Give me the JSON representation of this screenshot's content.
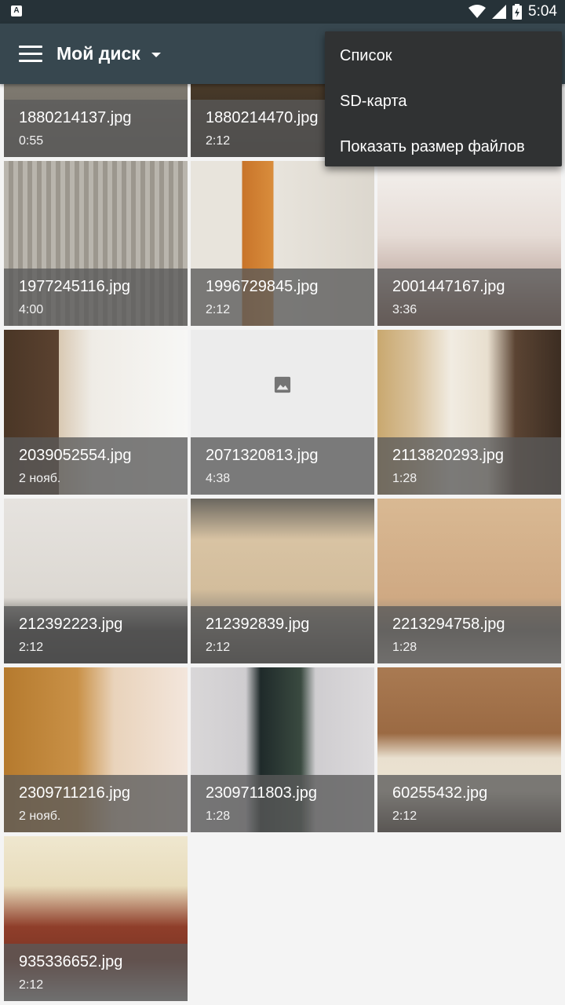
{
  "status_bar": {
    "time": "5:04",
    "notification_icon": "a-box-icon"
  },
  "app_bar": {
    "title": "Мой диск"
  },
  "menu": {
    "items": [
      {
        "label": "Список"
      },
      {
        "label": "SD-карта"
      },
      {
        "label": "Показать размер файлов"
      }
    ]
  },
  "files": [
    {
      "name": "1880214137.jpg",
      "sub": "0:55"
    },
    {
      "name": "1880214470.jpg",
      "sub": "2:12"
    },
    {
      "name": "1977245116.jpg",
      "sub": "4:00"
    },
    {
      "name": "1996729845.jpg",
      "sub": "2:12"
    },
    {
      "name": "2001447167.jpg",
      "sub": "3:36"
    },
    {
      "name": "2039052554.jpg",
      "sub": "2 нояб."
    },
    {
      "name": "2071320813.jpg",
      "sub": "4:38"
    },
    {
      "name": "2113820293.jpg",
      "sub": "1:28"
    },
    {
      "name": "212392223.jpg",
      "sub": "2:12"
    },
    {
      "name": "212392839.jpg",
      "sub": "2:12"
    },
    {
      "name": "2213294758.jpg",
      "sub": "1:28"
    },
    {
      "name": "2309711216.jpg",
      "sub": "2 нояб."
    },
    {
      "name": "2309711803.jpg",
      "sub": "1:28"
    },
    {
      "name": "60255432.jpg",
      "sub": "2:12"
    },
    {
      "name": "935336652.jpg",
      "sub": "2:12"
    }
  ]
}
